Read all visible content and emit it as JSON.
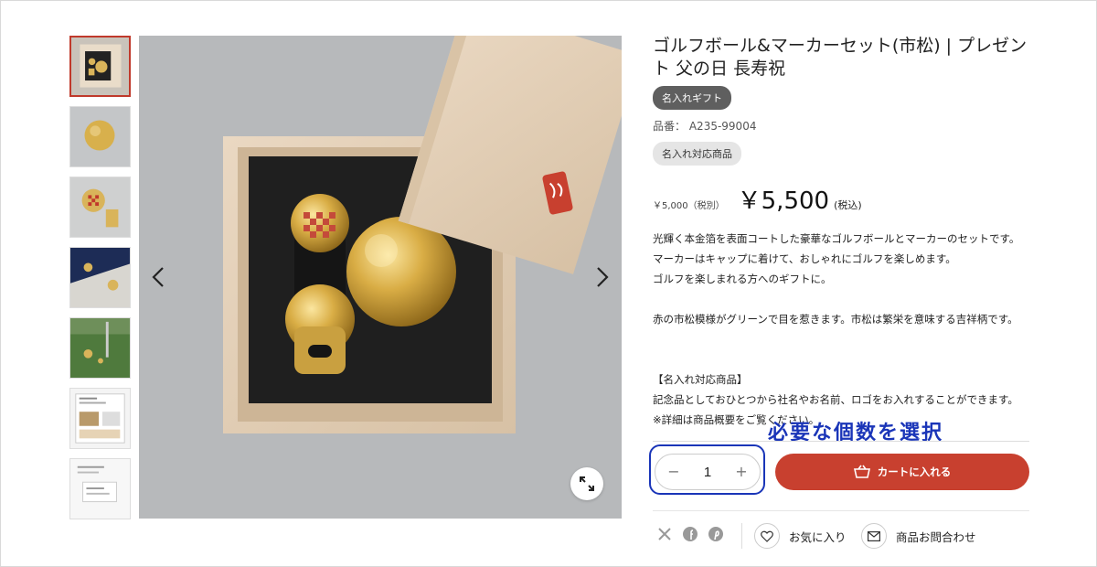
{
  "product": {
    "title": "ゴルフボール&マーカーセット(市松) | プレゼント 父の日 長寿祝",
    "badge_gift": "名入れギフト",
    "sku_label": "品番：",
    "sku_value": "A235-99004",
    "badge_name": "名入れ対応商品",
    "price_ex_tax": "￥5,000（税別）",
    "price": "￥5,500",
    "price_tax_note": "(税込)",
    "description": [
      "光輝く本金箔を表面コートした豪華なゴルフボールとマーカーのセットです。",
      "マーカーはキャップに着けて、おしゃれにゴルフを楽しめます。",
      "ゴルフを楽しまれる方へのギフトに。",
      "",
      "赤の市松模様がグリーンで目を惹きます。市松は繁栄を意味する吉祥柄です。",
      "",
      "",
      "【名入れ対応商品】",
      "記念品としておひとつから社名やお名前、ロゴをお入れすることができます。",
      "※詳細は商品概要をご覧ください。"
    ]
  },
  "callout": "必要な個数を選択",
  "quantity": {
    "value": "1",
    "minus": "−",
    "plus": "+"
  },
  "cart_button": "カートに入れる",
  "actions": {
    "favorite": "お気に入り",
    "inquiry": "商品お問合わせ"
  },
  "icons": {
    "thumbnails": [
      "box-set-thumb",
      "ball-thumb",
      "marker-thumb",
      "cap-thumb",
      "green-thumb",
      "leaflet-thumb",
      "card-thumb"
    ],
    "social": [
      "x-icon",
      "facebook-icon",
      "pinterest-icon"
    ]
  },
  "colors": {
    "accent_red": "#c8402f",
    "callout_blue": "#1a35b8",
    "badge_dark": "#5f5f5f",
    "badge_light": "#e5e5e5"
  }
}
